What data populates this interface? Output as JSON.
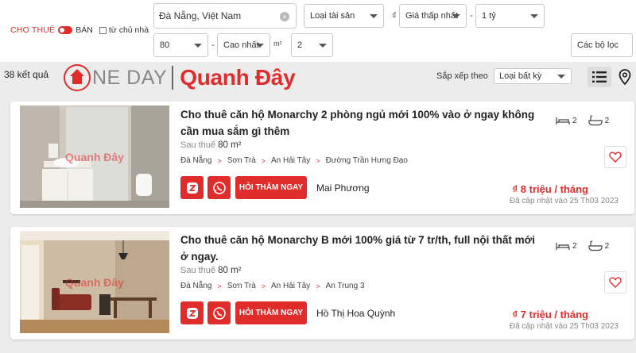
{
  "filters": {
    "mode_rent": "CHO THUÊ",
    "mode_sale": "BÁN",
    "owner_label": "từ chủ nhà",
    "location": "Đà Nẵng, Việt Nam",
    "property_type": "Loại tài sản",
    "currency_symbol": "₫",
    "price_min": "Giá thấp nhất",
    "dash": "-",
    "price_max": "1 tỷ",
    "area_min": "80",
    "area_max": "Cao nhất",
    "area_unit": "m²",
    "bedrooms": "2",
    "more_filters": "Các bộ lọc"
  },
  "results": {
    "count": "38 kết quả",
    "brand_one": "NE DAY",
    "brand_quanhday": "Quanh Đây",
    "sort_label": "Sắp xếp theo",
    "sort_value": "Loại bất kỳ"
  },
  "listings": [
    {
      "title": "Cho thuê căn hộ Monarchy 2 phòng ngủ mới 100% vào ở ngay không cần mua sắm gì thêm",
      "after_tax_label": "Sau thuế",
      "area": "80 m²",
      "crumbs": [
        "Đà Nẵng",
        "Sơn Trà",
        "An Hải Tây",
        "Đường Trần Hưng Đạo"
      ],
      "agent": "Mai Phương",
      "ask_label": "HỎI THĂM NGAY",
      "bedrooms": "2",
      "bathrooms": "2",
      "price": "₫ 8 triệu / tháng",
      "updated": "Đã cập nhật vào 25 Th03 2023",
      "watermark": "Quanh Đây"
    },
    {
      "title": "Cho thuê căn hộ Monarchy B mới 100% giá từ 7 tr/th, full nội thất mới ở ngay.",
      "after_tax_label": "Sau thuế",
      "area": "80 m²",
      "crumbs": [
        "Đà Nẵng",
        "Sơn Trà",
        "An Hải Tây",
        "An Trung 3"
      ],
      "agent": "Hồ Thị Hoa Quỳnh",
      "ask_label": "HỎI THĂM NGAY",
      "bedrooms": "2",
      "bathrooms": "2",
      "price": "₫ 7 triệu / tháng",
      "updated": "Đã cập nhật vào 25 Th03 2023",
      "watermark": "Quanh Đây"
    }
  ],
  "colors": {
    "accent": "#e12c2c"
  },
  "icons": [
    "house-logo-icon",
    "list-view-icon",
    "map-pin-icon",
    "bed-icon",
    "bath-icon",
    "heart-icon",
    "zalo-icon",
    "whatsapp-icon",
    "clear-icon",
    "chevron-down-icon"
  ]
}
